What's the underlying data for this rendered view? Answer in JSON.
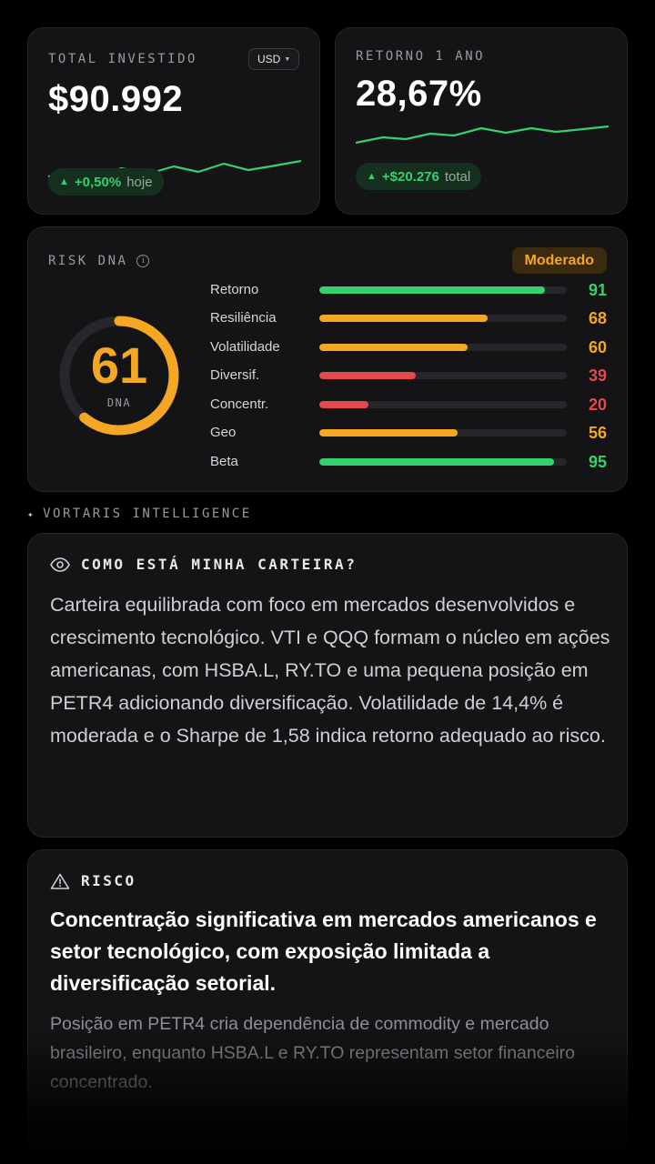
{
  "colors": {
    "green": "#34d16e",
    "orange": "#f5a623",
    "red": "#e5484d",
    "background": "#000000",
    "card": "#141416"
  },
  "total_card": {
    "label": "TOTAL INVESTIDO",
    "value": "$90.992",
    "currency": "USD",
    "delta_value": "+0,50%",
    "delta_suffix": "hoje"
  },
  "return_card": {
    "label": "RETORNO 1 ANO",
    "value": "28,67%",
    "delta_value": "+$20.276",
    "delta_suffix": "total"
  },
  "risk_dna": {
    "label": "RISK DNA",
    "info_icon": "i",
    "badge": "Moderado",
    "score": "61",
    "score_fraction": 0.61,
    "score_label": "DNA",
    "metrics": [
      {
        "label": "Retorno",
        "value": "91",
        "fraction": 0.91,
        "color": "#34d16e"
      },
      {
        "label": "Resiliência",
        "value": "68",
        "fraction": 0.68,
        "color": "#f5a623"
      },
      {
        "label": "Volatilidade",
        "value": "60",
        "fraction": 0.6,
        "color": "#f5a623"
      },
      {
        "label": "Diversif.",
        "value": "39",
        "fraction": 0.39,
        "color": "#e5484d"
      },
      {
        "label": "Concentr.",
        "value": "20",
        "fraction": 0.2,
        "color": "#e5484d"
      },
      {
        "label": "Geo",
        "value": "56",
        "fraction": 0.56,
        "color": "#f5a623"
      },
      {
        "label": "Beta",
        "value": "95",
        "fraction": 0.95,
        "color": "#34d16e"
      }
    ]
  },
  "intelligence": {
    "header": "VORTARIS INTELLIGENCE",
    "spark_icon": "✦",
    "insight": {
      "title": "COMO ESTÁ MINHA CARTEIRA?",
      "icon": "eye-icon",
      "body": "Carteira equilibrada com foco em mercados desenvolvidos e crescimento tecnológico. VTI e QQQ formam o núcleo em ações americanas, com HSBA.L, RY.TO e uma pequena posição em PETR4 adicionando diversificação. Volatilidade de 14,4% é moderada e o Sharpe de 1,58 indica retorno adequado ao risco."
    },
    "risk": {
      "title": "RISCO",
      "icon": "warning-icon",
      "headline": "Concentração significativa em mercados americanos e setor tecnológico, com exposição limitada a diversificação setorial.",
      "body": "Posição em PETR4 cria dependência de commodity e mercado brasileiro, enquanto HSBA.L e RY.TO representam setor financeiro concentrado."
    }
  }
}
